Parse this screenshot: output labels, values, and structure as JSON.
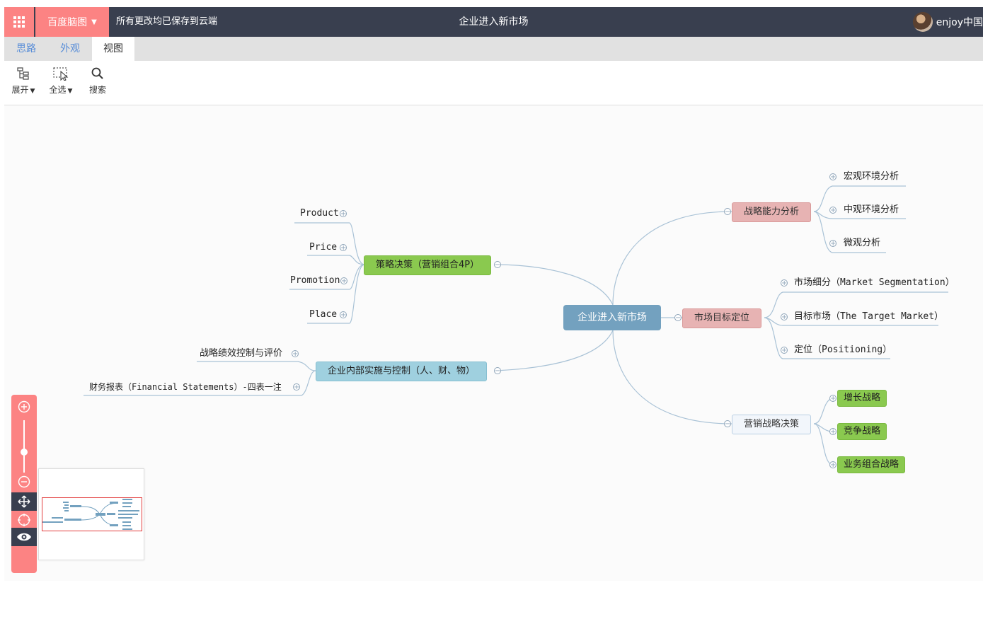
{
  "topbar": {
    "brand": "百度脑图",
    "save_status": "所有更改均已保存到云端",
    "doc_title": "企业进入新市场",
    "user_name": "enjoy中国"
  },
  "tabs": [
    "思路",
    "外观",
    "视图"
  ],
  "active_tab": "视图",
  "toolbar": {
    "expand": "展开",
    "select_all": "全选",
    "search": "搜索"
  },
  "mindmap": {
    "root": "企业进入新市场",
    "strategy_4p": {
      "label": "策略决策（营销组合4P）",
      "children": [
        "Product",
        "Price",
        "Promotion",
        "Place"
      ]
    },
    "internal": {
      "label": "企业内部实施与控制（人、财、物）",
      "children": [
        "战略绩效控制与评价",
        "财务报表（Financial Statements）-四表一注"
      ]
    },
    "capability": {
      "label": "战略能力分析",
      "children": [
        "宏观环境分析",
        "中观环境分析",
        "微观分析"
      ]
    },
    "positioning": {
      "label": "市场目标定位",
      "children": [
        "市场细分（Market Segmentation）",
        "目标市场（The Target Market）",
        "定位（Positioning）"
      ]
    },
    "marketing": {
      "label": "营销战略决策",
      "children": [
        "增长战略",
        "竞争战略",
        "业务组合战略"
      ]
    }
  },
  "colors": {
    "topbar": "#393f4f",
    "accent": "#fc8383",
    "root": "#73a1bf",
    "red_node": "#e7b3b3",
    "green_node": "#8ac94f",
    "blue_node": "#9fd0df",
    "line": "#a9c2d6"
  },
  "icons": {
    "apps": "apps-grid-icon",
    "expand": "tree-expand-icon",
    "select_all": "select-cursor-icon",
    "search": "search-icon",
    "zoom_in": "zoom-in-icon",
    "zoom_out": "zoom-out-icon",
    "move": "move-icon",
    "locate": "locate-icon",
    "view": "eye-icon"
  }
}
